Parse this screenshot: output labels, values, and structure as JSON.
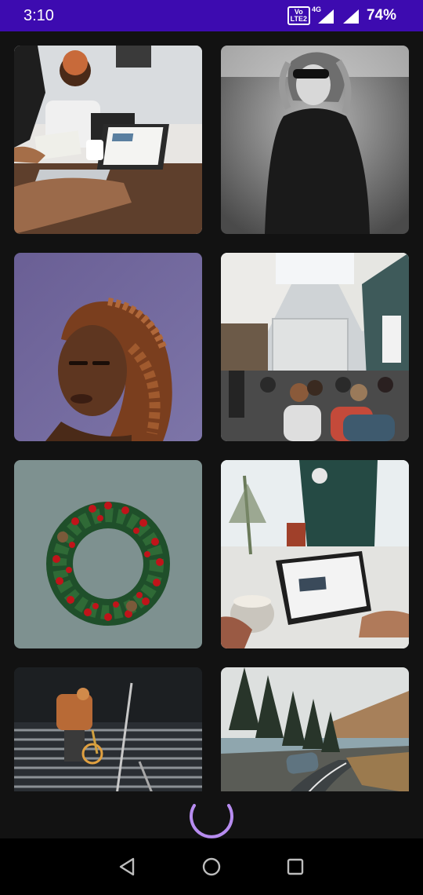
{
  "status_bar": {
    "time": "3:10",
    "volte_top": "Vo",
    "volte_bottom": "LTE2",
    "network": "4G",
    "battery": "74%",
    "background_color": "#3d0bb0"
  },
  "gallery": {
    "images": [
      {
        "subject": "meeting-laptop-photo"
      },
      {
        "subject": "woman-sunglasses-bw-photo"
      },
      {
        "subject": "woman-curly-hair-portrait-photo"
      },
      {
        "subject": "presentation-room-photo"
      },
      {
        "subject": "christmas-wreath-photo"
      },
      {
        "subject": "tablet-on-table-photo"
      },
      {
        "subject": "cyclist-on-stairs-photo"
      },
      {
        "subject": "coastal-road-photo"
      }
    ]
  },
  "loader": {
    "color": "#b78cf0"
  },
  "nav_bar": {
    "icons": [
      "back-icon",
      "home-icon",
      "recents-icon"
    ]
  }
}
